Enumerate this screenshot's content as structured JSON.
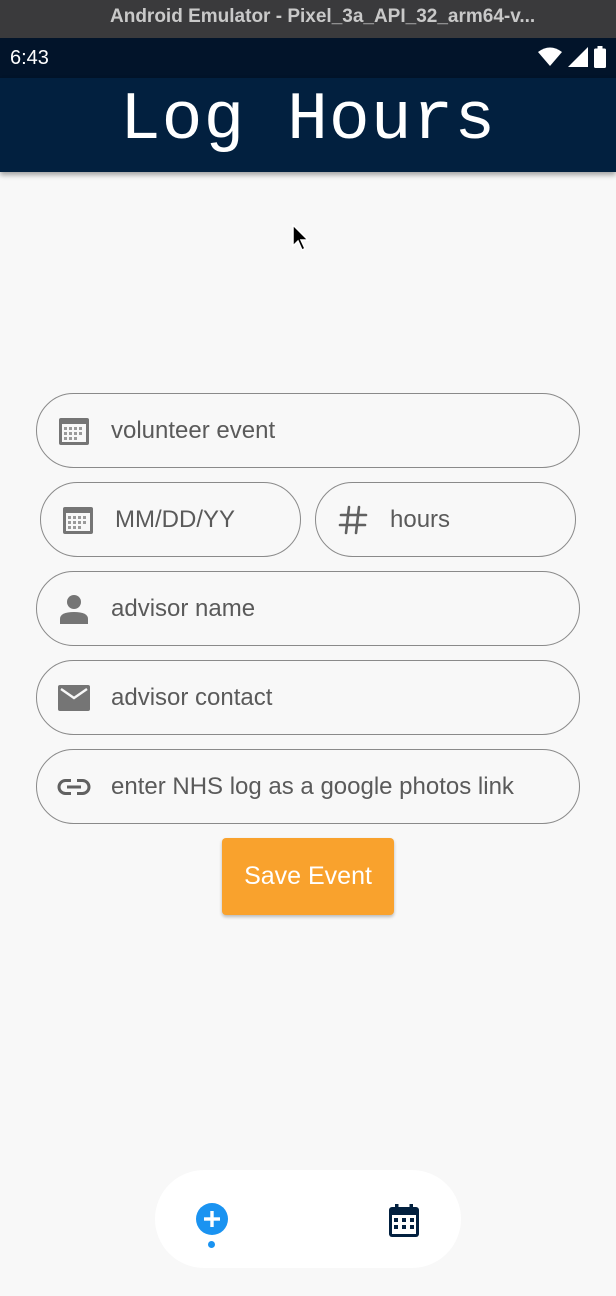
{
  "window": {
    "title": "Android Emulator - Pixel_3a_API_32_arm64-v..."
  },
  "status_bar": {
    "time": "6:43",
    "icons": [
      "wifi-icon",
      "cell-signal-icon",
      "battery-icon"
    ]
  },
  "app_bar": {
    "title": "Log Hours",
    "background": "#02203f"
  },
  "form": {
    "event_name": {
      "placeholder": "volunteer event",
      "value": "",
      "icon": "calendar-icon"
    },
    "date": {
      "placeholder": "MM/DD/YY",
      "value": "",
      "icon": "calendar-icon"
    },
    "hours": {
      "placeholder": "hours",
      "value": "",
      "icon": "hash-icon"
    },
    "advisor_name": {
      "placeholder": "advisor name",
      "value": "",
      "icon": "person-icon"
    },
    "advisor_contact": {
      "placeholder": "advisor contact",
      "value": "",
      "icon": "email-icon"
    },
    "photos_link": {
      "placeholder": "enter NHS log as a google photos link",
      "value": "",
      "icon": "link-icon"
    },
    "save_label": "Save Event",
    "save_color": "#f9a22d"
  },
  "bottom_nav": {
    "items": [
      {
        "name": "add",
        "icon": "add-circle-icon",
        "selected": true,
        "color": "#1a93f1"
      },
      {
        "name": "calendar",
        "icon": "calendar-month-icon",
        "selected": false,
        "color": "#02203f"
      }
    ]
  }
}
